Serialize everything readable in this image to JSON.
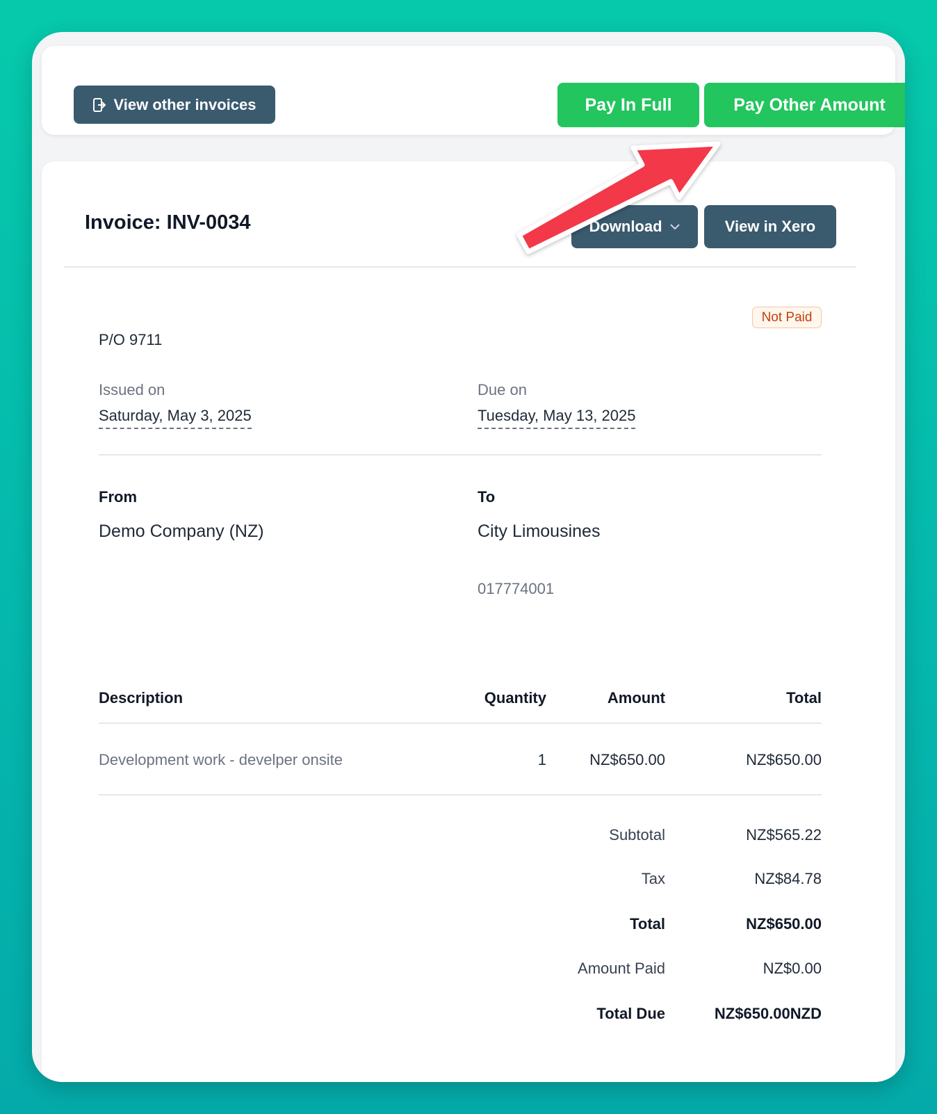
{
  "topbar": {
    "view_other_label": "View other invoices",
    "pay_full_label": "Pay In Full",
    "pay_other_label": "Pay Other Amount"
  },
  "invoice": {
    "title": "Invoice: INV-0034",
    "download_label": "Download",
    "xero_label": "View in Xero",
    "status": "Not Paid",
    "reference": "P/O 9711",
    "issued_label": "Issued on",
    "issued_date": "Saturday, May 3, 2025",
    "due_label": "Due on",
    "due_date": "Tuesday, May 13, 2025",
    "from_label": "From",
    "from_name": "Demo Company (NZ)",
    "to_label": "To",
    "to_name": "City Limousines",
    "to_account": "017774001"
  },
  "table": {
    "headers": [
      "Description",
      "Quantity",
      "Amount",
      "Total"
    ],
    "rows": [
      {
        "description": "Development work - develper onsite",
        "quantity": "1",
        "amount": "NZ$650.00",
        "total": "NZ$650.00"
      }
    ]
  },
  "totals": {
    "subtotal_label": "Subtotal",
    "subtotal": "NZ$565.22",
    "tax_label": "Tax",
    "tax": "NZ$84.78",
    "total_label": "Total",
    "total": "NZ$650.00",
    "paid_label": "Amount Paid",
    "paid": "NZ$0.00",
    "due_label": "Total Due",
    "due": "NZ$650.00NZD"
  },
  "colors": {
    "green": "#22c55e",
    "dark_button": "#3a5a6e",
    "arrow": "#f2394a",
    "badge_text": "#c2410c"
  }
}
